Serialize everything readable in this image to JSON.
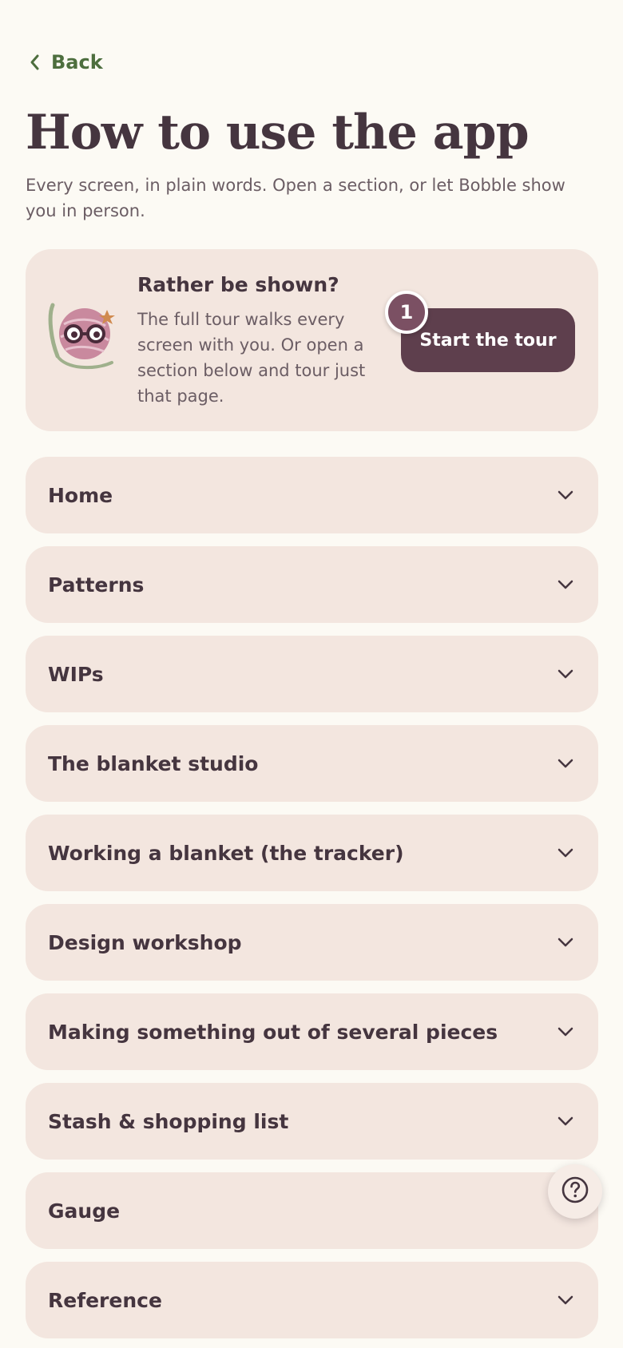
{
  "nav": {
    "back_label": "Back"
  },
  "page": {
    "title": "How to use the app",
    "subtitle": "Every screen, in plain words. Open a section, or let Bobble show you in person."
  },
  "tour": {
    "heading": "Rather be shown?",
    "text": "The full tour walks every screen with you. Or open a section below and tour just that page.",
    "button_label": "Start the tour",
    "step_badge": "1"
  },
  "sections": [
    {
      "label": "Home"
    },
    {
      "label": "Patterns"
    },
    {
      "label": "WIPs"
    },
    {
      "label": "The blanket studio"
    },
    {
      "label": "Working a blanket (the tracker)"
    },
    {
      "label": "Design workshop"
    },
    {
      "label": "Making something out of several pieces"
    },
    {
      "label": "Stash & shopping list"
    },
    {
      "label": "Gauge"
    },
    {
      "label": "Reference"
    }
  ],
  "icons": {
    "back": "chevron-left-icon",
    "expand": "chevron-down-icon",
    "help": "question-mark-icon",
    "mascot": "yarn-ball-mascot-icon"
  },
  "colors": {
    "background": "#fcfaf4",
    "card": "#f3e6df",
    "text": "#45353f",
    "accent_green": "#4d6e3e",
    "button": "#5e3f4d",
    "badge": "#7b5063"
  }
}
